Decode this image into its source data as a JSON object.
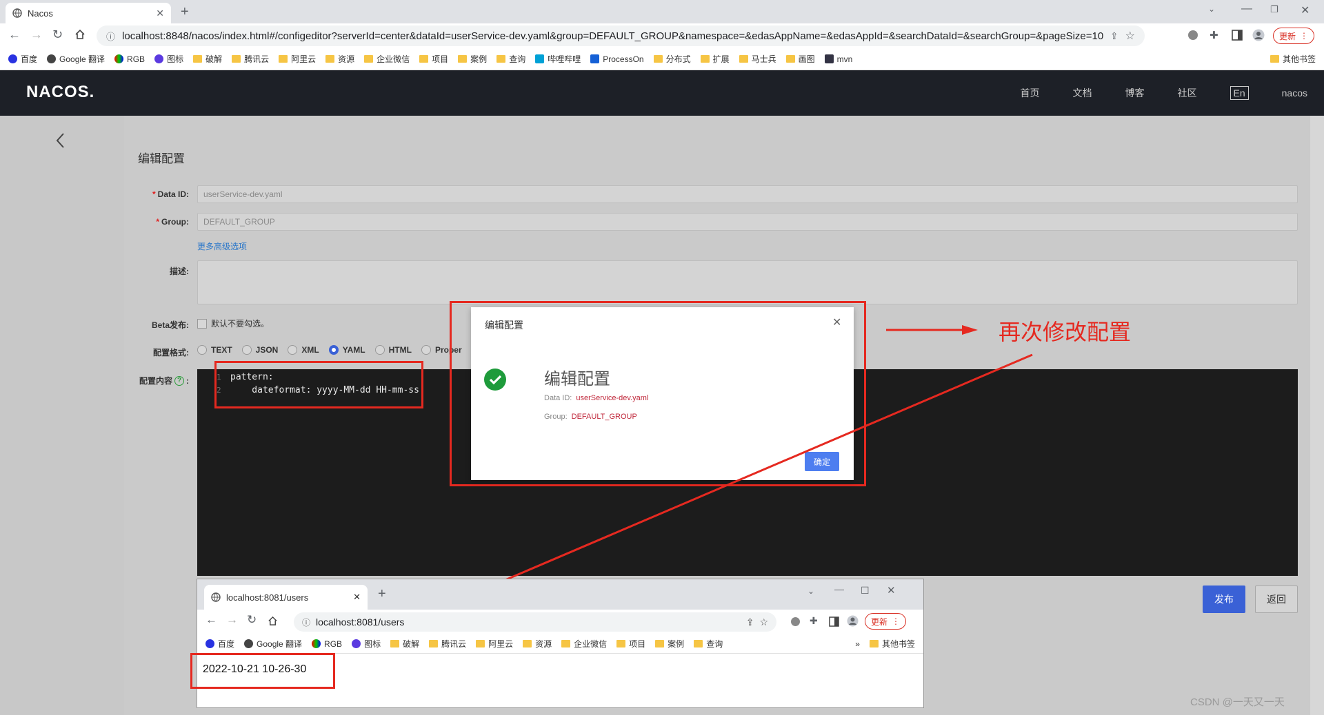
{
  "browser": {
    "tab_title": "Nacos",
    "url": "localhost:8848/nacos/index.html#/configeditor?serverId=center&dataId=userService-dev.yaml&group=DEFAULT_GROUP&namespace=&edasAppName=&edasAppId=&searchDataId=&searchGroup=&pageSize=10...",
    "update_label": "更新",
    "bookmarks": [
      "百度",
      "Google 翻译",
      "RGB",
      "图标",
      "破解",
      "腾讯云",
      "阿里云",
      "资源",
      "企业微信",
      "项目",
      "案例",
      "查询",
      "哔哩哔哩",
      "ProcessOn",
      "分布式",
      "扩展",
      "马士兵",
      "画图",
      "mvn"
    ],
    "other_bookmarks": "其他书签"
  },
  "nacos": {
    "logo": "NACOS.",
    "nav": [
      "首页",
      "文档",
      "博客",
      "社区"
    ],
    "lang": "En",
    "user": "nacos"
  },
  "form": {
    "title": "编辑配置",
    "data_id_label": "Data ID:",
    "data_id_value": "userService-dev.yaml",
    "group_label": "Group:",
    "group_value": "DEFAULT_GROUP",
    "more_options": "更多高级选项",
    "desc_label": "描述:",
    "beta_label": "Beta发布:",
    "beta_hint": "默认不要勾选。",
    "format_label": "配置格式:",
    "formats": [
      "TEXT",
      "JSON",
      "XML",
      "YAML",
      "HTML",
      "Proper"
    ],
    "selected_format": "YAML",
    "content_label": "配置内容",
    "code_lines": [
      "pattern:",
      "    dateformat: yyyy-MM-dd HH-mm-ss"
    ],
    "publish_label": "发布",
    "back_label": "返回"
  },
  "dialog": {
    "header": "编辑配置",
    "title": "编辑配置",
    "data_id_label": "Data ID:",
    "data_id_value": "userService-dev.yaml",
    "group_label": "Group:",
    "group_value": "DEFAULT_GROUP",
    "ok_label": "确定"
  },
  "annotation": {
    "text": "再次修改配置",
    "color": "#e52920"
  },
  "inner_browser": {
    "tab_title": "localhost:8081/users",
    "url": "localhost:8081/users",
    "update_label": "更新",
    "bookmarks": [
      "百度",
      "Google 翻译",
      "RGB",
      "图标",
      "破解",
      "腾讯云",
      "阿里云",
      "资源",
      "企业微信",
      "项目",
      "案例",
      "查询"
    ],
    "more": "»",
    "other_bookmarks": "其他书签",
    "body_text": "2022-10-21 10-26-30"
  },
  "watermark": "CSDN @一天又一天"
}
